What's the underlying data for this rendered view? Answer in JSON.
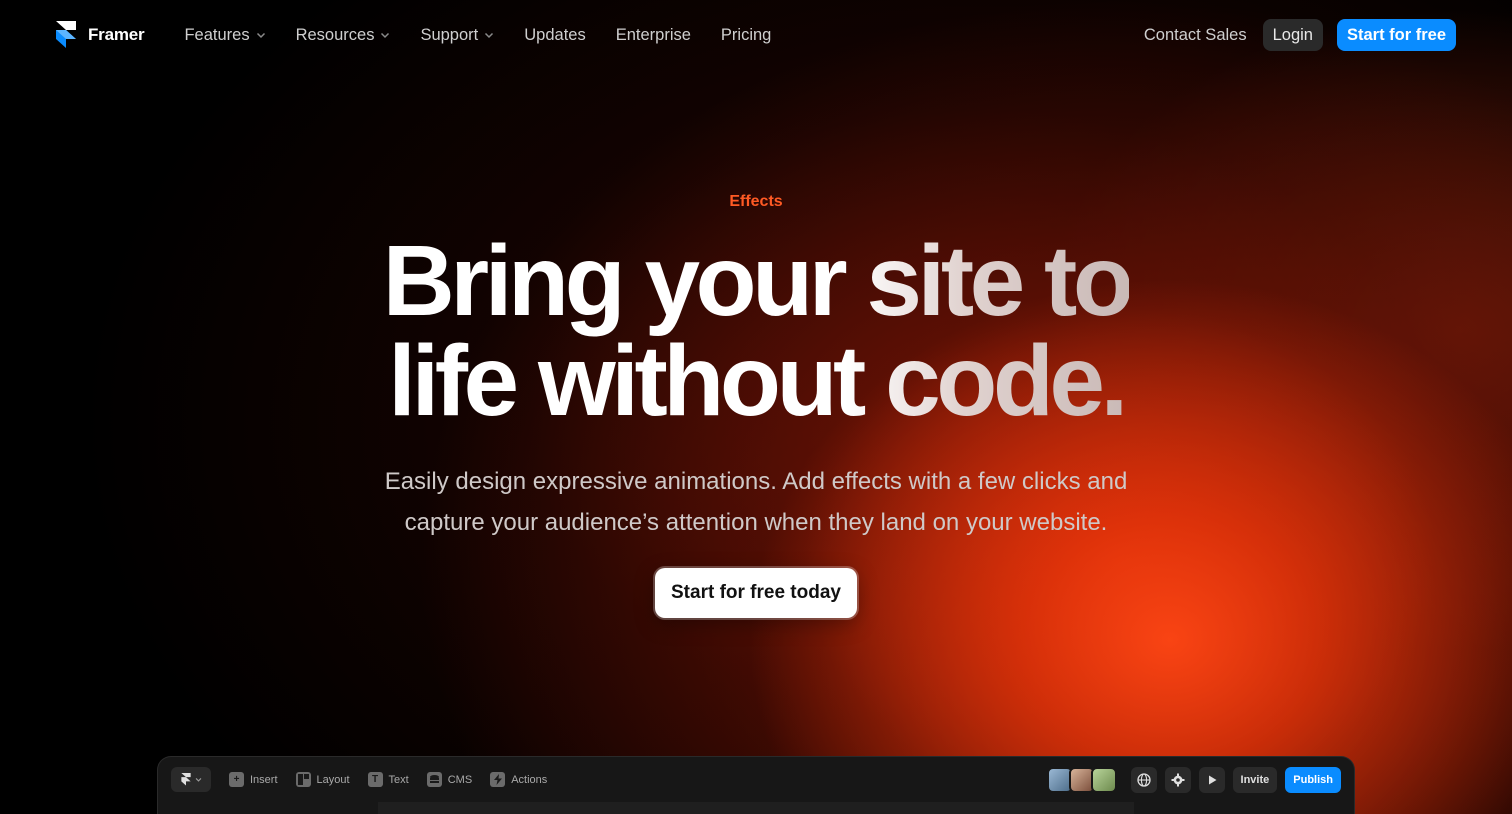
{
  "nav": {
    "brand": "Framer",
    "links": [
      {
        "label": "Features",
        "dropdown": true
      },
      {
        "label": "Resources",
        "dropdown": true
      },
      {
        "label": "Support",
        "dropdown": true
      },
      {
        "label": "Updates",
        "dropdown": false
      },
      {
        "label": "Enterprise",
        "dropdown": false
      },
      {
        "label": "Pricing",
        "dropdown": false
      }
    ],
    "contact_label": "Contact Sales",
    "login_label": "Login",
    "start_label": "Start for free"
  },
  "hero": {
    "eyebrow": "Effects",
    "headline_line1": "Bring your site to",
    "headline_line2": "life without code.",
    "subhead": "Easily design expressive animations. Add effects with a few clicks and capture your audience’s attention when they land on your website.",
    "cta_label": "Start for free today"
  },
  "editor": {
    "tools": [
      {
        "label": "Insert",
        "icon": "plus-icon"
      },
      {
        "label": "Layout",
        "icon": "layout-icon"
      },
      {
        "label": "Text",
        "icon": "text-icon"
      },
      {
        "label": "CMS",
        "icon": "database-icon"
      },
      {
        "label": "Actions",
        "icon": "bolt-icon"
      }
    ],
    "invite_label": "Invite",
    "publish_label": "Publish"
  },
  "colors": {
    "accent_blue": "#0a8cff",
    "eyebrow_orange": "#ff5a24",
    "glow_orange": "#ff4614"
  }
}
